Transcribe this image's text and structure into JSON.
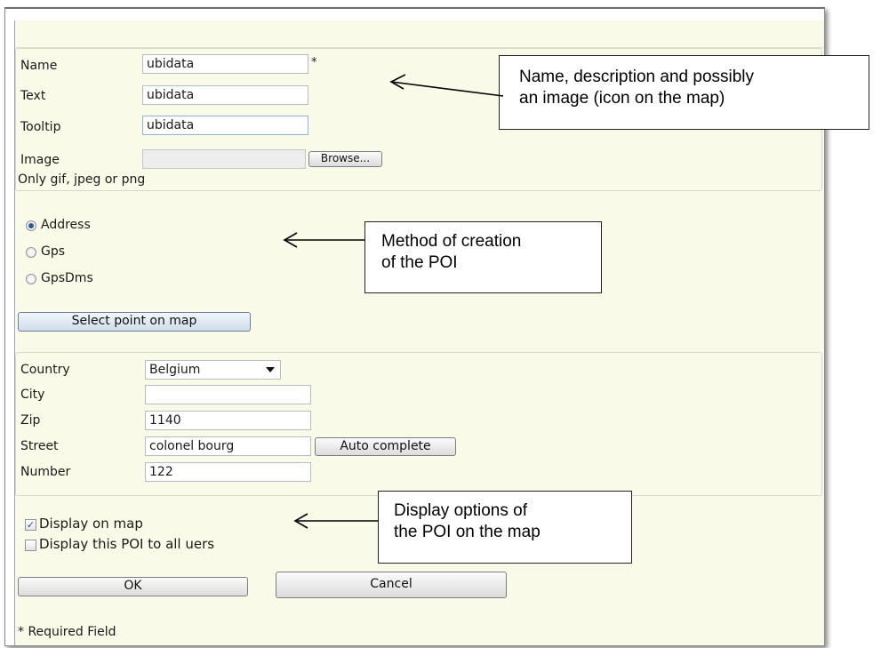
{
  "identity": {
    "name_label": "Name",
    "name_value": "ubidata",
    "required_marker": "*",
    "text_label": "Text",
    "text_value": "ubidata",
    "tooltip_label": "Tooltip",
    "tooltip_value": "ubidata",
    "image_label": "Image",
    "browse_label": "Browse...",
    "image_hint": "Only gif, jpeg or png"
  },
  "method": {
    "options": [
      {
        "label": "Address",
        "selected": true
      },
      {
        "label": "Gps",
        "selected": false
      },
      {
        "label": "GpsDms",
        "selected": false
      }
    ],
    "select_point_label": "Select point on map"
  },
  "address": {
    "country_label": "Country",
    "country_value": "Belgium",
    "city_label": "City",
    "city_value": "",
    "zip_label": "Zip",
    "zip_value": "1140",
    "street_label": "Street",
    "street_value": "colonel bourg",
    "autocomplete_label": "Auto complete",
    "number_label": "Number",
    "number_value": "122"
  },
  "display": {
    "display_on_map_label": "Display on map",
    "display_on_map_checked": true,
    "display_all_users_label": "Display this POI to all uers",
    "display_all_users_checked": false
  },
  "actions": {
    "ok_label": "OK",
    "cancel_label": "Cancel"
  },
  "footer": {
    "required_note": "* Required Field"
  },
  "callouts": {
    "identity": [
      "Name, description and possibly",
      "an image (icon on the map)"
    ],
    "method": [
      "Method of creation",
      "of the POI"
    ],
    "display": [
      "Display options of",
      "the POI on the map"
    ]
  },
  "icons": {
    "dropdown": "chevron-down-icon",
    "check": "checkmark-icon"
  },
  "colors": {
    "panel_background": "#fafae8",
    "radio_selected": "#2b5c99",
    "field_border": "#b4bcc4"
  }
}
